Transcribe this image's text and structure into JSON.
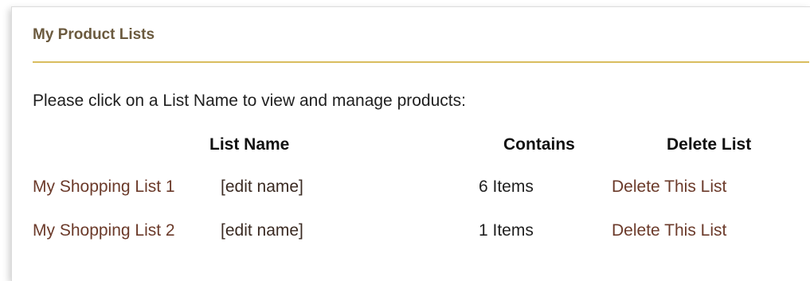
{
  "panel": {
    "title": "My Product Lists",
    "intro": "Please click on a List Name to view and manage products:"
  },
  "table": {
    "headers": {
      "list_name": "List Name",
      "contains": "Contains",
      "delete_list": "Delete List"
    },
    "rows": [
      {
        "name": "My Shopping List 1",
        "edit_label": "[edit name]",
        "contains": "6 Items",
        "delete_label": "Delete This List"
      },
      {
        "name": "My Shopping List 2",
        "edit_label": "[edit name]",
        "contains": "1 Items",
        "delete_label": "Delete This List"
      }
    ]
  },
  "colors": {
    "title_text": "#6b5a3e",
    "title_rule": "#d9bd5e",
    "link_text": "#6b3a2a"
  }
}
